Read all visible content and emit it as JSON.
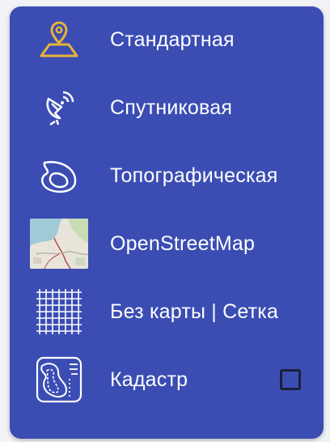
{
  "menu": {
    "items": [
      {
        "label": "Стандартная",
        "icon": "map-pin-icon",
        "selected": true,
        "accent": "#e8b33a"
      },
      {
        "label": "Спутниковая",
        "icon": "satellite-dish-icon"
      },
      {
        "label": "Топографическая",
        "icon": "topography-contour-icon"
      },
      {
        "label": "OpenStreetMap",
        "icon": "osm-map-thumbnail"
      },
      {
        "label": "Без карты | Сетка",
        "icon": "grid-icon"
      },
      {
        "label": "Кадастр",
        "icon": "cadastre-map-icon",
        "checkbox_checked": false
      }
    ]
  },
  "colors": {
    "panel": "#3b4db3",
    "text": "#ffffff",
    "selected_icon": "#e8b33a"
  }
}
